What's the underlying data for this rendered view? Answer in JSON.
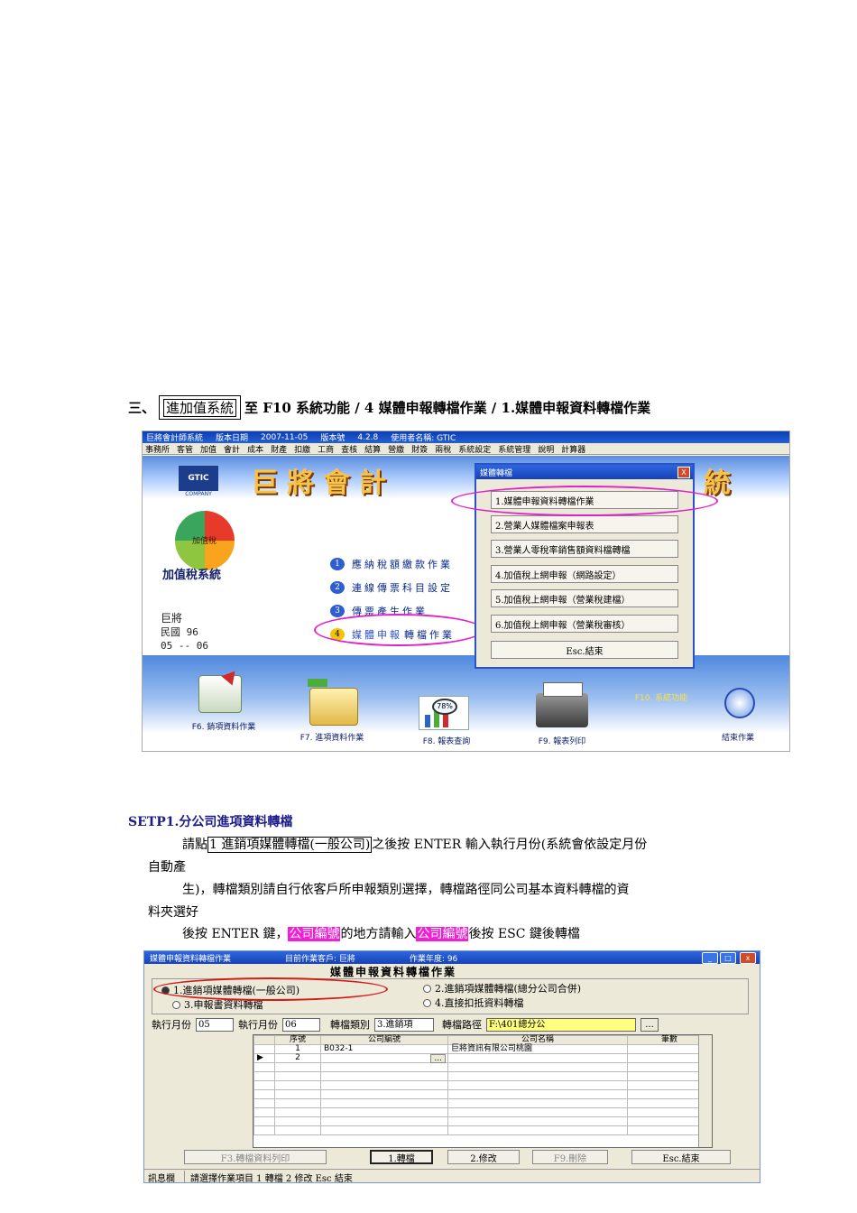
{
  "heading": {
    "prefix": "三、",
    "boxed": "進加值系統",
    "rest": "至 F10 系統功能  / 4 媒體申報轉檔作業  / 1.媒體申報資料轉檔作業"
  },
  "shot1": {
    "title_bar": [
      "巨將會計師系統",
      "版本日期",
      "2007-11-05",
      "版本號",
      "4.2.8",
      "使用者名稱: GTIC"
    ],
    "menu": [
      "事務所",
      "客管",
      "加值",
      "會計",
      "成本",
      "財產",
      "扣繳",
      "工商",
      "查核",
      "結算",
      "營繳",
      "財簽",
      "兩稅",
      "系統設定",
      "系統管理",
      "說明",
      "計算器"
    ],
    "banner_title": "巨將會計",
    "banner_tail": "統",
    "gtic": "GTIC",
    "gtic_sub": "COMPANY",
    "logo_pie_label": "加值稅",
    "logo_label": "加值稅系統",
    "company": "巨將",
    "date_line1": "民國  96",
    "date_line2": "05 -- 06",
    "menu_items": [
      {
        "num": "1",
        "label": "應納稅額繳款作業"
      },
      {
        "num": "2",
        "label": "連線傳票科目設定"
      },
      {
        "num": "3",
        "label": "傳票產生作業"
      },
      {
        "num": "4",
        "label_a": "媒體申報",
        "label_b": "轉檔作業"
      }
    ],
    "dialog": {
      "title": "媒體轉檔",
      "close": "X",
      "buttons": [
        "1.媒體申報資料轉檔作業",
        "2.營業人媒體檔案申報表",
        "3.營業人零稅率銷售額資料檔轉檔",
        "4.加值稅上網申報（網路設定）",
        "5.加值稅上網申報（營業稅建檔）",
        "6.加值稅上網申報（營業稅審核）",
        "Esc.結束"
      ]
    },
    "bottom_icons": {
      "f6": "F6. 銷項資料作業",
      "f7": "F7. 進項資料作業",
      "f8": "F8. 報表查詢",
      "f8_pct": "78%",
      "f9": "F9. 報表列印",
      "f10": "F10. 系統功能",
      "end": "結束作業"
    }
  },
  "setp": {
    "title": "SETP1.分公司進項資料轉檔",
    "p1_a": "請點",
    "p1_box": "1 進銷項媒體轉檔(一般公司)",
    "p1_b": "之後按 ENTER 輸入執行月份(系統會依設定月份",
    "p1_c": "自動產",
    "p2_a": "生)，轉檔類別請自行依客戶所申報類別選擇，轉檔路徑同公司基本資料轉檔的資",
    "p2_b": "料夾選好",
    "p3_a": "後按 ENTER 鍵，",
    "p3_hl1": "公司編號",
    "p3_b": "的地方請輸入",
    "p3_hl2": "公司編號",
    "p3_c": "後按 ESC 鍵後轉檔"
  },
  "shot2": {
    "title_left": "媒體申報資料轉檔作業",
    "title_mid": "目前作業客戶: 巨將",
    "title_right": "作業年度: 96",
    "form_title": "媒體申報資料轉檔作業",
    "radios": [
      "1.進銷項媒體轉檔(一般公司)",
      "2.進銷項媒體轉檔(總分公司合併)",
      "3.申報書資料轉檔",
      "4.直接扣抵資料轉檔"
    ],
    "fields": {
      "exec_month_from_label": "執行月份",
      "exec_month_from": "05",
      "exec_month_to_label": "執行月份",
      "exec_month_to": "06",
      "type_label": "轉檔類別",
      "type_value": "3.進銷項",
      "path_label": "轉檔路徑",
      "path_value": "F:\\401總分公",
      "browse": "..."
    },
    "table": {
      "headers": [
        "序號",
        "公司編號",
        "公司名稱",
        "筆數"
      ],
      "rows": [
        [
          "1",
          "B032-1",
          "巨將資訊有限公司桃園",
          ""
        ],
        [
          "2",
          "",
          "",
          ""
        ]
      ],
      "row_button": "..."
    },
    "buttons": [
      "F3.轉檔資料列印",
      "1.轉檔",
      "2.修改",
      "F9.刪除",
      "Esc.結束"
    ],
    "status_label": "訊息欄",
    "status_text": "請選擇作業項目 1 轉檔 2 修改 Esc 結束"
  }
}
